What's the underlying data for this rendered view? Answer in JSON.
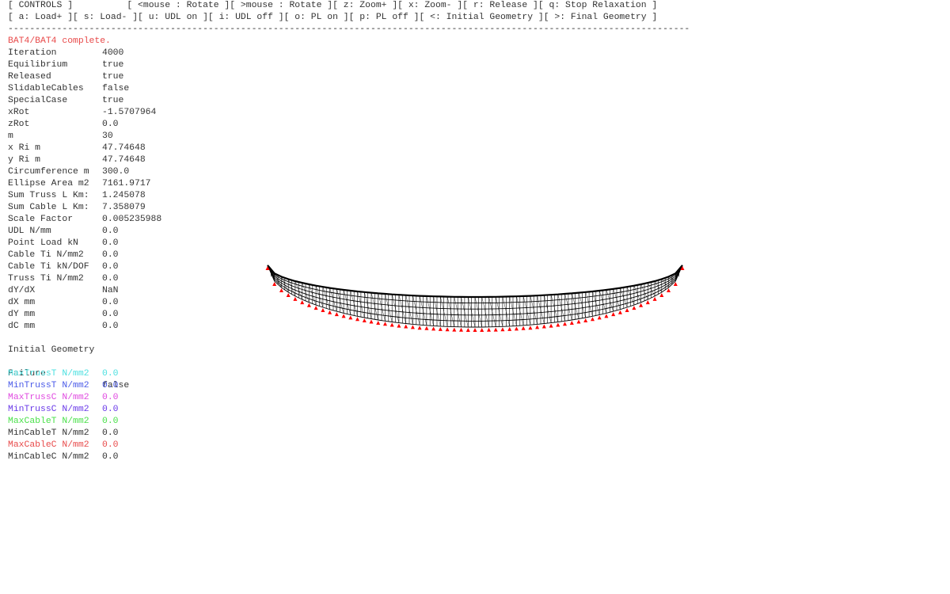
{
  "controls": {
    "line1": "[ CONTROLS ]          [ <mouse : Rotate ][ >mouse : Rotate ][ z: Zoom+ ][ x: Zoom- ][ r: Release ][ q: Stop Relaxation ]",
    "line2": "[ a: Load+ ][ s: Load- ][ u: UDL on ][ i: UDL off ][ o: PL on ][ p: PL off ][ <: Initial Geometry ][ >: Final Geometry ]",
    "separator": "------------------------------------------------------------------------------------------------------------------------------"
  },
  "status_message": "BAT4/BAT4 complete.",
  "stats": [
    {
      "label": "Iteration",
      "value": "4000"
    },
    {
      "label": "Equilibrium",
      "value": "true"
    },
    {
      "label": "Released",
      "value": "true"
    },
    {
      "label": "SlidableCables",
      "value": "false"
    },
    {
      "label": "SpecialCase",
      "value": "true"
    },
    {
      "label": "xRot",
      "value": "-1.5707964"
    },
    {
      "label": "zRot",
      "value": "0.0"
    },
    {
      "label": "m",
      "value": "30"
    },
    {
      "label": "x Ri m",
      "value": "47.74648"
    },
    {
      "label": "y Ri m",
      "value": "47.74648"
    },
    {
      "label": "Circumference m",
      "value": "300.0"
    },
    {
      "label": "Ellipse Area m2",
      "value": "7161.9717"
    },
    {
      "label": "Sum Truss L Km:",
      "value": "1.245078"
    },
    {
      "label": "Sum Cable L Km:",
      "value": "7.358079"
    },
    {
      "label": "Scale Factor",
      "value": "0.005235988"
    },
    {
      "label": "UDL N/mm",
      "value": "0.0"
    },
    {
      "label": "Point Load kN",
      "value": "0.0"
    },
    {
      "label": "Cable Ti N/mm2",
      "value": "0.0"
    },
    {
      "label": "Cable Ti kN/DOF",
      "value": "0.0"
    },
    {
      "label": "Truss Ti N/mm2",
      "value": "0.0"
    },
    {
      "label": "dY/dX",
      "value": "NaN"
    },
    {
      "label": "dX mm",
      "value": "0.0"
    },
    {
      "label": "dY mm",
      "value": "0.0"
    },
    {
      "label": "dC mm",
      "value": "0.0"
    }
  ],
  "geometry_heading": "Initial Geometry",
  "failure": {
    "label": "Failure",
    "value": "false"
  },
  "stress_rows": [
    {
      "label": "MaxTrussT N/mm2",
      "value": "0.0",
      "color": "#4de0e0"
    },
    {
      "label": "MinTrussT N/mm2",
      "value": "0.0",
      "color": "#4a5ae8"
    },
    {
      "label": "MaxTrussC N/mm2",
      "value": "0.0",
      "color": "#e04ae0"
    },
    {
      "label": "MinTrussC N/mm2",
      "value": "0.0",
      "color": "#6a3ae8"
    },
    {
      "label": "MaxCableT N/mm2",
      "value": "0.0",
      "color": "#4ae04a"
    },
    {
      "label": "MinCableT N/mm2",
      "value": "0.0",
      "color": "#333333"
    },
    {
      "label": "MaxCableC N/mm2",
      "value": "0.0",
      "color": "#e84a4a"
    },
    {
      "label": "MinCableC N/mm2",
      "value": "0.0",
      "color": "#333333"
    }
  ],
  "model": {
    "segments": 30,
    "support_color": "#ff0000",
    "mesh_color": "#000000"
  }
}
